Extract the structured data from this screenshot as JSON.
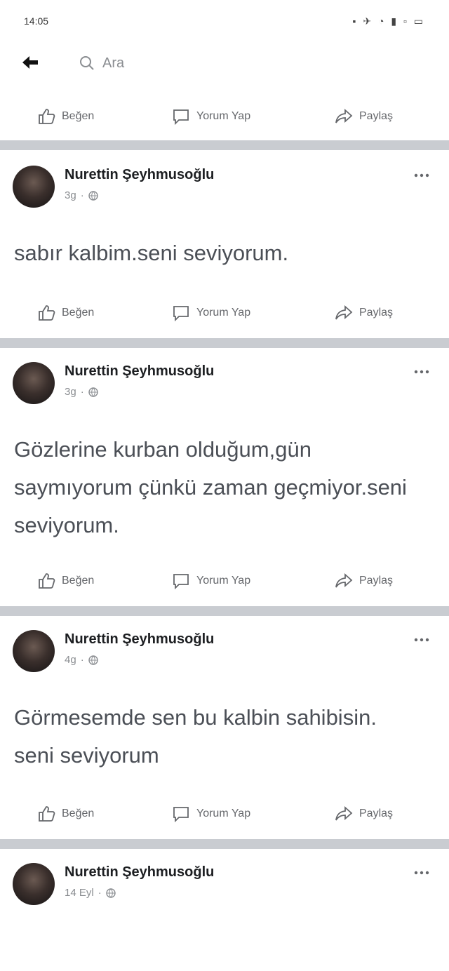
{
  "status_bar": {
    "time": "14:05",
    "icons": "▪ ✈ ◔ ▮ ▫ ▭"
  },
  "search": {
    "placeholder": "Ara"
  },
  "actions": {
    "like": "Beğen",
    "comment": "Yorum Yap",
    "share": "Paylaş"
  },
  "posts": [
    {
      "author": "Nurettin Şeyhmusoğlu",
      "time": "3g",
      "text": "sabır kalbim.seni seviyorum."
    },
    {
      "author": "Nurettin Şeyhmusoğlu",
      "time": "3g",
      "text": "Gözlerine kurban olduğum,gün saymıyorum çünkü zaman geçmiyor.seni seviyorum."
    },
    {
      "author": "Nurettin Şeyhmusoğlu",
      "time": "4g",
      "text": "Görmesemde sen bu kalbin sahibisin. seni seviyorum"
    },
    {
      "author": "Nurettin Şeyhmusoğlu",
      "time": "14 Eyl"
    }
  ],
  "icons": [
    "back-arrow-icon",
    "search-icon",
    "like-icon",
    "comment-icon",
    "share-icon",
    "globe-icon",
    "more-icon"
  ]
}
